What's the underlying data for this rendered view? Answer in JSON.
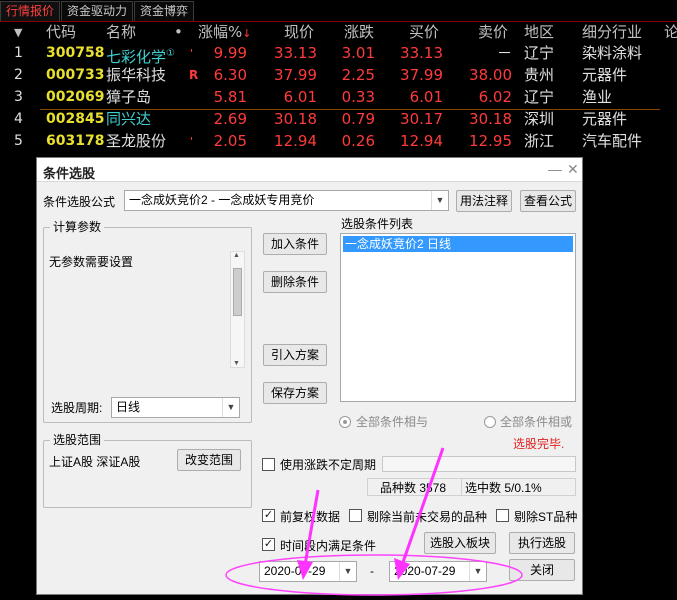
{
  "tabs": [
    "行情报价",
    "资金驱动力",
    "资金博弈"
  ],
  "columns": {
    "code": "代码",
    "name": "名称",
    "dot": "•",
    "change_pct": "涨幅%",
    "price": "现价",
    "change": "涨跌",
    "bid": "买价",
    "ask": "卖价",
    "region": "地区",
    "industry": "细分行业"
  },
  "rows": [
    {
      "idx": "1",
      "code": "300758",
      "name": "七彩化学",
      "mark": "①",
      "flag": "'",
      "change_pct": "9.99",
      "price": "33.13",
      "change": "3.01",
      "bid": "33.13",
      "ask": "－",
      "region": "辽宁",
      "industry": "染料涂料"
    },
    {
      "idx": "2",
      "code": "000733",
      "name": "振华科技",
      "mark": "",
      "flag": "R",
      "change_pct": "6.30",
      "price": "37.99",
      "change": "2.25",
      "bid": "37.99",
      "ask": "38.00",
      "region": "贵州",
      "industry": "元器件"
    },
    {
      "idx": "3",
      "code": "002069",
      "name": "獐子岛",
      "mark": "",
      "flag": "",
      "change_pct": "5.81",
      "price": "6.01",
      "change": "0.33",
      "bid": "6.01",
      "ask": "6.02",
      "region": "辽宁",
      "industry": "渔业"
    },
    {
      "idx": "4",
      "code": "002845",
      "name": "同兴达",
      "mark": "",
      "flag": "",
      "change_pct": "2.69",
      "price": "30.18",
      "change": "0.79",
      "bid": "30.17",
      "ask": "30.18",
      "region": "深圳",
      "industry": "元器件"
    },
    {
      "idx": "5",
      "code": "603178",
      "name": "圣龙股份",
      "mark": "",
      "flag": "'",
      "change_pct": "2.05",
      "price": "12.94",
      "change": "0.26",
      "bid": "12.94",
      "ask": "12.95",
      "region": "浙江",
      "industry": "汽车配件"
    }
  ],
  "dialog": {
    "title": "条件选股",
    "formula_label": "条件选股公式",
    "formula_value": "一念成妖竞价2 - 一念成妖专用竞价",
    "usage_btn": "用法注释",
    "view_formula_btn": "查看公式",
    "params_group": "计算参数",
    "params_text": "无参数需要设置",
    "period_label": "选股周期:",
    "period_value": "日线",
    "add_btn": "加入条件",
    "delete_btn": "删除条件",
    "import_btn": "引入方案",
    "save_btn": "保存方案",
    "conditions_label": "选股条件列表",
    "conditions": [
      "一念成妖竞价2  日线"
    ],
    "radio_and": "全部条件相与",
    "radio_or": "全部条件相或",
    "status": "选股完毕.",
    "range_group": "选股范围",
    "range_text": "上证A股 深证A股",
    "change_range_btn": "改变范围",
    "use_uncertain_period": "使用涨跌不定周期",
    "count_label": "品种数 3578",
    "selected_label": "选中数 5/0.1%",
    "pre_adjust": "前复权数据",
    "exclude_suspended": "剔除当前未交易的品种",
    "exclude_st": "剔除ST品种",
    "time_condition": "时间段内满足条件",
    "to_block_btn": "选股入板块",
    "execute_btn": "执行选股",
    "close_btn": "关闭",
    "date_from": "2020-07-29",
    "date_sep": "-",
    "date_to": "2020-07-29"
  }
}
